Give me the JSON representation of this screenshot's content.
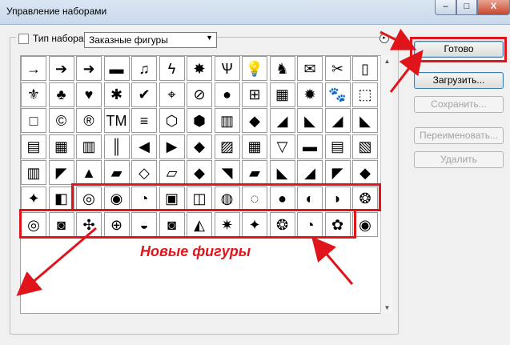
{
  "window": {
    "title": "Управление наборами",
    "min": "–",
    "max": "□",
    "close": "X"
  },
  "type_label": "Тип набора:",
  "type_select": "Заказные фигуры",
  "menu_icon": "▸",
  "buttons": {
    "done": "Готово",
    "load": "Загрузить...",
    "save": "Сохранить...",
    "rename": "Переименовать...",
    "delete": "Удалить"
  },
  "annotation": "Новые фигуры",
  "shapes": [
    [
      "→",
      "➔",
      "➜",
      "▬",
      "♫",
      "ϟ",
      "✸",
      "Ѱ",
      "💡",
      "♞",
      "✉",
      "✂",
      "▯"
    ],
    [
      "⚜",
      "♣",
      "♥",
      "✱",
      "✔",
      "⌖",
      "⊘",
      "●",
      "⊞",
      "▦",
      "✹",
      "🐾",
      "⬚"
    ],
    [
      "□",
      "©",
      "®",
      "TM",
      "≡",
      "⬡",
      "⬢",
      "▥",
      "◆",
      "◢",
      "◣",
      "◢",
      "◣"
    ],
    [
      "▤",
      "▦",
      "▥",
      "║",
      "◀",
      "▶",
      "◆",
      "▨",
      "▦",
      "▽",
      "▬",
      "▤",
      "▧"
    ],
    [
      "▥",
      "◤",
      "▲",
      "▰",
      "◇",
      "▱",
      "◆",
      "◥",
      "▰",
      "◣",
      "◢",
      "◤",
      "◆"
    ],
    [
      "✦",
      "◧",
      "◎",
      "◉",
      "◔",
      "▣",
      "◫",
      "◍",
      "◌",
      "●",
      "◐",
      "◗",
      "❂"
    ],
    [
      "◎",
      "◙",
      "✣",
      "⊕",
      "◒",
      "◙",
      "◭",
      "✷",
      "✦",
      "❂",
      "◔",
      "✿",
      "◉"
    ]
  ],
  "scroll": {
    "up": "▲",
    "down": "▼"
  }
}
